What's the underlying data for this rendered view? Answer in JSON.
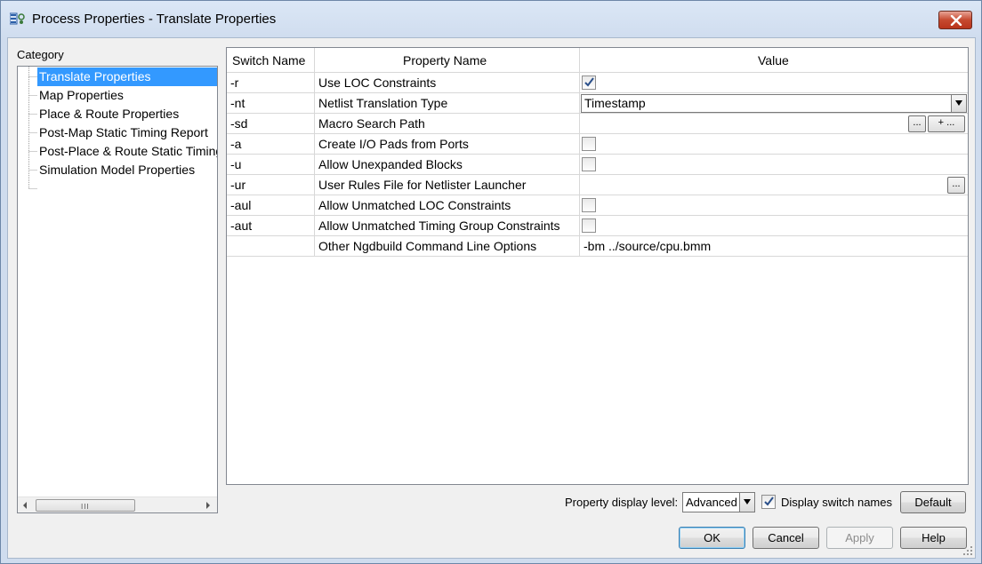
{
  "window": {
    "title": "Process Properties - Translate Properties",
    "icon": "process-properties-icon"
  },
  "category": {
    "label": "Category",
    "items": [
      {
        "label": "Translate Properties",
        "selected": true
      },
      {
        "label": "Map Properties",
        "selected": false
      },
      {
        "label": "Place & Route Properties",
        "selected": false
      },
      {
        "label": "Post-Map Static Timing Report",
        "selected": false
      },
      {
        "label": "Post-Place & Route Static Timing Report",
        "selected": false
      },
      {
        "label": "Simulation Model Properties",
        "selected": false
      }
    ],
    "scroll_grip": "III"
  },
  "table": {
    "headers": {
      "switch": "Switch Name",
      "property": "Property Name",
      "value": "Value"
    },
    "rows": [
      {
        "switch": "-r",
        "property": "Use LOC Constraints",
        "value_type": "checkbox",
        "checked": true
      },
      {
        "switch": "-nt",
        "property": "Netlist Translation Type",
        "value_type": "select",
        "value": "Timestamp"
      },
      {
        "switch": "-sd",
        "property": "Macro Search Path",
        "value_type": "path-list",
        "browse_label": "...",
        "add_label": "+ ..."
      },
      {
        "switch": "-a",
        "property": "Create I/O Pads from Ports",
        "value_type": "checkbox",
        "checked": false
      },
      {
        "switch": "-u",
        "property": "Allow Unexpanded Blocks",
        "value_type": "checkbox",
        "checked": false
      },
      {
        "switch": "-ur",
        "property": "User Rules File for Netlister Launcher",
        "value_type": "file",
        "browse_label": "..."
      },
      {
        "switch": "-aul",
        "property": "Allow Unmatched LOC Constraints",
        "value_type": "checkbox",
        "checked": false
      },
      {
        "switch": "-aut",
        "property": "Allow Unmatched Timing Group Constraints",
        "value_type": "checkbox",
        "checked": false
      },
      {
        "switch": "",
        "property": "Other Ngdbuild Command Line Options",
        "value_type": "text",
        "value": "-bm ../source/cpu.bmm"
      }
    ]
  },
  "footer": {
    "display_level_label": "Property display level:",
    "display_level_value": "Advanced",
    "display_switch_names_label": "Display switch names",
    "display_switch_names_checked": true,
    "default_label": "Default",
    "ok_label": "OK",
    "cancel_label": "Cancel",
    "apply_label": "Apply",
    "help_label": "Help"
  },
  "colors": {
    "selection": "#3399ff",
    "close_button": "#c6492f",
    "focus_border": "#3c7fb1"
  }
}
